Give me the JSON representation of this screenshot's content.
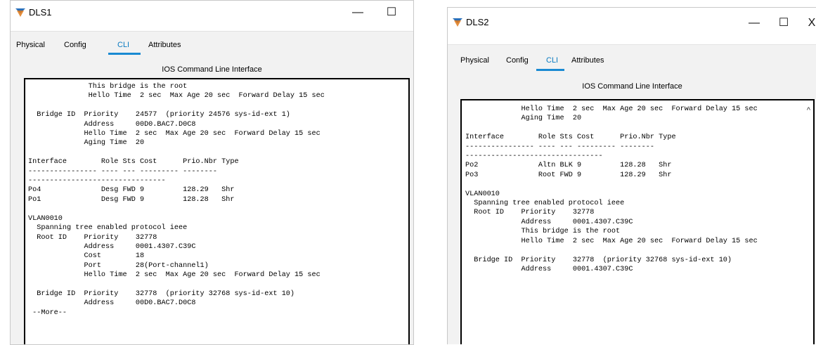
{
  "left": {
    "title": "DLS1",
    "tabs": [
      "Physical",
      "Config",
      "CLI",
      "Attributes"
    ],
    "panel_title": "IOS Command Line Interface",
    "cli_text": "              This bridge is the root\n              Hello Time  2 sec  Max Age 20 sec  Forward Delay 15 sec\n\n  Bridge ID  Priority    24577  (priority 24576 sys-id-ext 1)\n             Address     00D0.BAC7.D0C8\n             Hello Time  2 sec  Max Age 20 sec  Forward Delay 15 sec\n             Aging Time  20\n\nInterface        Role Sts Cost      Prio.Nbr Type\n---------------- ---- --- --------- --------\n--------------------------------\nPo4              Desg FWD 9         128.29   Shr\nPo1              Desg FWD 9         128.28   Shr\n\nVLAN0010\n  Spanning tree enabled protocol ieee\n  Root ID    Priority    32778\n             Address     0001.4307.C39C\n             Cost        18\n             Port        28(Port-channel1)\n             Hello Time  2 sec  Max Age 20 sec  Forward Delay 15 sec\n\n  Bridge ID  Priority    32778  (priority 32768 sys-id-ext 10)\n             Address     00D0.BAC7.D0C8\n --More--"
  },
  "right": {
    "title": "DLS2",
    "tabs": [
      "Physical",
      "Config",
      "CLI",
      "Attributes"
    ],
    "panel_title": "IOS Command Line Interface",
    "cli_text": "             Hello Time  2 sec  Max Age 20 sec  Forward Delay 15 sec\n             Aging Time  20\n\nInterface        Role Sts Cost      Prio.Nbr Type\n---------------- ---- --- --------- --------\n--------------------------------\nPo2              Altn BLK 9         128.28   Shr\nPo3              Root FWD 9         128.29   Shr\n\nVLAN0010\n  Spanning tree enabled protocol ieee\n  Root ID    Priority    32778\n             Address     0001.4307.C39C\n             This bridge is the root\n             Hello Time  2 sec  Max Age 20 sec  Forward Delay 15 sec\n\n  Bridge ID  Priority    32778  (priority 32768 sys-id-ext 10)\n             Address     0001.4307.C39C"
  },
  "controls": {
    "minimize": "—",
    "maximize": "☐",
    "close": "X"
  },
  "scroll_up": "^",
  "colors": {
    "accent": "#1a8ad2",
    "panel_bg": "#f2f2f2",
    "terminal_border": "#000000"
  }
}
